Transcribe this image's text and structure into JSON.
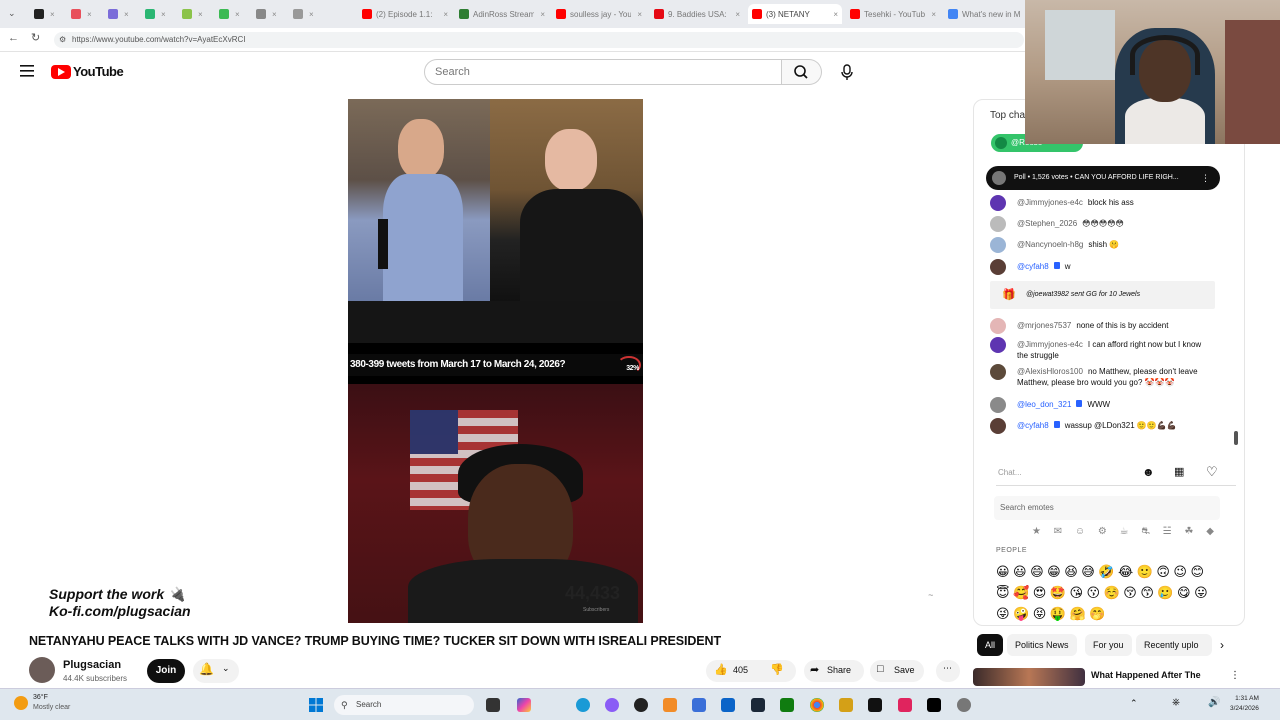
{
  "browser": {
    "tabs": [
      {
        "label": "",
        "color": "#222222"
      },
      {
        "label": "",
        "color": "#e8505b"
      },
      {
        "label": "",
        "color": "#7b6cd9"
      },
      {
        "label": "",
        "color": "#2bb673"
      },
      {
        "label": "",
        "color": "#8bc34a"
      },
      {
        "label": "",
        "color": "#3cba54"
      },
      {
        "label": "",
        "color": "#888888"
      },
      {
        "label": "",
        "color": "#999999"
      },
      {
        "label": "(2) Episode 1.1: ",
        "color": "#ff0000"
      },
      {
        "label": "AdinRoss Stream",
        "color": "#2e7d32"
      },
      {
        "label": "soulless jay - You",
        "color": "#ff0000"
      },
      {
        "label": "9. Baddies USA: E",
        "color": "#e50914"
      },
      {
        "label": "(3) NETANY",
        "color": "#ff0000",
        "active": true
      },
      {
        "label": "Tesehki - YouTub",
        "color": "#ff0000"
      },
      {
        "label": "What's new in M",
        "color": "#4285f4"
      }
    ],
    "url": "https://www.youtube.com/watch?v=AyatEcXvRCI"
  },
  "youtube": {
    "logo_text": "YouTube",
    "search_placeholder": "Search"
  },
  "video": {
    "caption": "380-399 tweets from March 17 to March 24, 2026?",
    "caption_pct": "32%",
    "support_line1": "Support the work 🔌",
    "support_line2": "Ko-fi.com/plugsacian",
    "sub_count": "44,433",
    "sub_count_label": "Subscribers",
    "title": "NETANYAHU PEACE TALKS WITH JD VANCE? TRUMP BUYING TIME? TUCKER SIT DOWN WITH ISREALI PRESIDENT"
  },
  "channel": {
    "name": "Plugsacian",
    "subscribers": "44.4K subscribers",
    "join_label": "Join"
  },
  "actions": {
    "likes": "405",
    "share": "Share",
    "save": "Save"
  },
  "chat": {
    "header": "Top cha",
    "pinned": "@Reese",
    "poll": "Poll • 1,526 votes • CAN YOU AFFORD LIFE RIGH...",
    "messages": [
      {
        "author": "@Jimmyjones-e4c",
        "text": "block his ass",
        "color": "#5e35b1",
        "member": false
      },
      {
        "author": "@Stephen_2026",
        "text": "😳😳😳😳😳",
        "color": "#bbbbbb",
        "member": false
      },
      {
        "author": "@Nancynoeln-h8g",
        "text": "shish 🤫",
        "color": "#9bb5d6",
        "member": false
      },
      {
        "author": "@cyfah8",
        "text": "w",
        "color": "#5a3e36",
        "member": true
      }
    ],
    "gift_text": "@joewat3982  sent GG for 10 Jewels",
    "messages2": [
      {
        "author": "@mrjones7537",
        "text": "none of this is by accident",
        "color": "#e4b6b6",
        "member": false
      },
      {
        "author": "@Jimmyjones-e4c",
        "text": "I can afford right now but I know the struggle",
        "color": "#5e35b1",
        "member": false
      },
      {
        "author": "@AlexisHloros100",
        "text": "no Matthew, please don't leave Matthew, please bro would you go? 🤡🤡🤡",
        "color": "#5c4a3a",
        "member": false
      },
      {
        "author": "@leo_don_321",
        "text": "WWW",
        "color": "#8a8a8a",
        "member": true
      },
      {
        "author": "@cyfah8",
        "text": "wassup @LDon321 🙂🙂💪🏿💪🏿",
        "color": "#5a3e36",
        "member": true
      }
    ],
    "input_placeholder": "Chat...",
    "emote_search": "Search emotes",
    "emote_categories": "★ ✉ ☺ ⚙ ☕ ⛐ ☱ ☘ ◆",
    "people_label": "PEOPLE",
    "emojis": "😀😃😄😁😆😅🤣😂🙂🙃😉😊😇🥰😍🤩😘😗☺️😚😙🥲😋😛😜🤪😝🤑🤗🤭"
  },
  "chips": [
    "All",
    "Politics News",
    "For you",
    "Recently uplo"
  ],
  "recommendation": {
    "title": "What Happened After The"
  },
  "taskbar": {
    "temp": "36°F",
    "weather": "Mostly clear",
    "search": "Search",
    "time": "1:31 AM",
    "date": "3/24/2026"
  }
}
